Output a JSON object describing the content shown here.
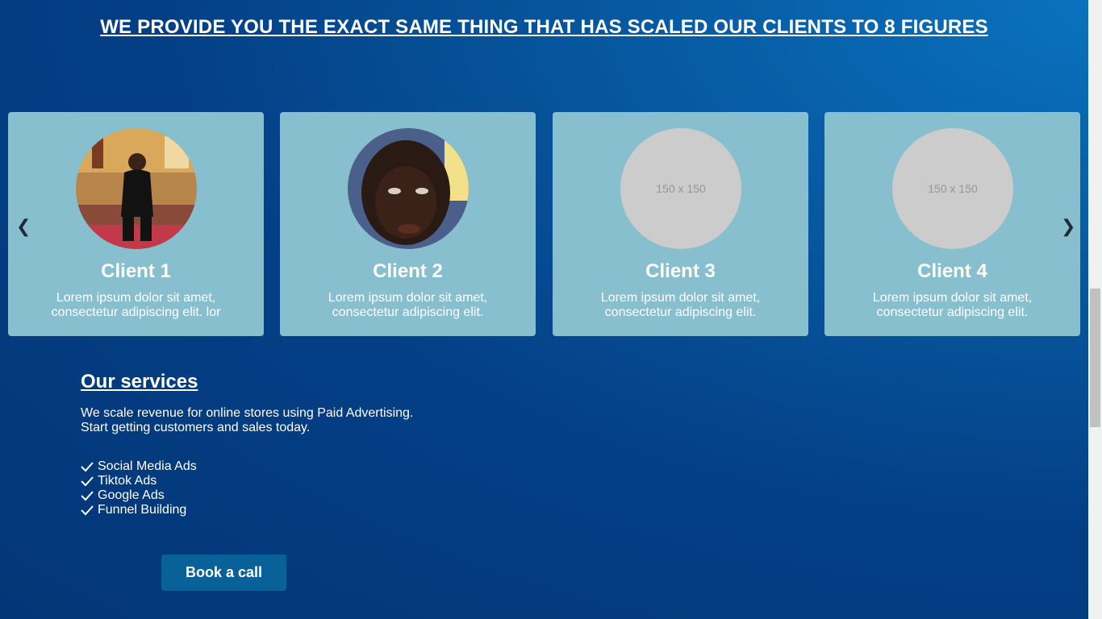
{
  "headline": "WE PROVIDE YOU THE EXACT SAME THING THAT HAS SCALED OUR CLIENTS TO 8 FIGURES",
  "carousel": {
    "prev_icon": "❮",
    "next_icon": "❯",
    "cards": [
      {
        "title": "Client 1",
        "text": "Lorem ipsum dolor sit amet, consectetur adipiscing elit. lor",
        "photo": "photo-person-in-black"
      },
      {
        "title": "Client 2",
        "text": "Lorem ipsum dolor sit amet, consectetur adipiscing elit.",
        "photo": "photo-face-closeup"
      },
      {
        "title": "Client 3",
        "text": "Lorem ipsum dolor sit amet, consectetur adipiscing elit.",
        "placeholder": "150 x 150"
      },
      {
        "title": "Client 4",
        "text": "Lorem ipsum dolor sit amet, consectetur adipiscing elit.",
        "placeholder": "150 x 150"
      }
    ]
  },
  "services": {
    "title": "Our services",
    "description": "We scale revenue for online stores using Paid Advertising. Start getting customers and sales today.",
    "items": [
      "Social Media Ads",
      "Tiktok Ads",
      "Google Ads",
      "Funnel Building"
    ],
    "item_icon": "check-icon"
  },
  "cta": {
    "label": "Book a call"
  },
  "colors": {
    "card": "#88bfcf",
    "button": "#09619a",
    "placeholder": "#cccccc"
  }
}
